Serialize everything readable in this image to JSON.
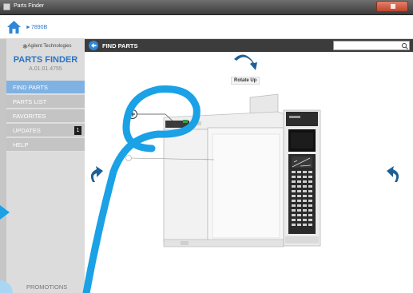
{
  "window": {
    "title": "Parts Finder"
  },
  "navbar": {
    "breadcrumb": "7890B",
    "crumb_arrow": "►"
  },
  "sidebar": {
    "brand": "Agilent Technologies",
    "title": "PARTS FINDER",
    "version": "A.01.01.4755",
    "items": [
      {
        "label": "FIND PARTS",
        "active": true
      },
      {
        "label": "PARTS LIST"
      },
      {
        "label": "FAVORITES"
      },
      {
        "label": "UPDATES",
        "badge": "1"
      },
      {
        "label": "HELP"
      }
    ],
    "promotions": "PROMOTIONS"
  },
  "header": {
    "title": "FIND PARTS",
    "search_placeholder": ""
  },
  "canvas": {
    "rotate_up_label": "Rotate Up"
  },
  "colors": {
    "accent": "#2b73c4",
    "annotation": "#1aa1e6",
    "header_bg": "#3c3c3c",
    "sidebar_bg": "#dcdcdc"
  }
}
